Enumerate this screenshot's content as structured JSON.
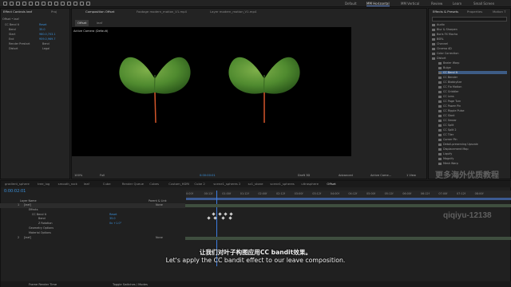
{
  "workspaces": [
    "Default",
    "MM Horizontal",
    "MM Vertical",
    "Review",
    "Learn",
    "Small Screen"
  ],
  "active_workspace_index": 1,
  "effect_controls": {
    "tabs": [
      "Effect Controls leaf",
      "Proj"
    ],
    "subtitle": "Offset • leaf",
    "rows": [
      {
        "label": "CC Bend It",
        "value": "Reset"
      },
      {
        "label": "Bend",
        "value": "35.0"
      },
      {
        "label": "Start",
        "value": "960.0,703.1"
      },
      {
        "label": "End",
        "value": "959.0,969.7"
      },
      {
        "label": "Render Prestart",
        "value": "Bend"
      },
      {
        "label": "Distort",
        "value": "Legal"
      }
    ]
  },
  "composition": {
    "tabs": [
      "Composition Offset",
      "Footage modern_motion_V1.mp4",
      "Layer modern_motion_V1.mp4"
    ],
    "crumbs": [
      "Offset",
      "leaf"
    ],
    "camera_label": "Active Camera (Default)",
    "footer": [
      "100%",
      "Full",
      "0:00:00:01",
      "Draft 3D",
      "Advanced",
      "Active Came...",
      "1 View"
    ]
  },
  "effects_presets": {
    "tabs": [
      "Effects & Presets",
      "Properties",
      "Motion T"
    ],
    "items": [
      "Audio",
      "Blur & Sharpen",
      "Boris FX Mocha",
      "BSRL",
      "Channel",
      "Cinema 4D",
      "Color Correction",
      "Distort",
      "Bezier Warp",
      "Bulge",
      "CC Bend It",
      "CC Bender",
      "CC Blobbylize",
      "CC Flo Motion",
      "CC Griddler",
      "CC Lens",
      "CC Page Turn",
      "CC Power Pin",
      "CC Ripple Pulse",
      "CC Slant",
      "CC Smear",
      "CC Split",
      "CC Split 2",
      "CC Tiler",
      "Corner Pin",
      "Detail-preserving Upscale",
      "Displacement Map",
      "Liquify",
      "Magnify",
      "Mesh Warp"
    ],
    "selected_index": 10
  },
  "timeline": {
    "tabs": [
      "gradient_sphere",
      "tree_log",
      "smooth_rock",
      "leaf",
      "Cube",
      "Render Queue",
      "Cubes",
      "Custom_HDRI",
      "Cube 2",
      "scene1_spheres 2",
      "sc1_stone",
      "scene1_spheres",
      "ultrasphere",
      "Offset"
    ],
    "timecode": "0:00:02:01",
    "columns": [
      "Layer Name",
      "Parent & Link"
    ],
    "layers": [
      {
        "num": "1",
        "name": "[leaf]",
        "parent": "None"
      },
      {
        "name": "Effects",
        "parent": ""
      },
      {
        "name": "CC Bend It",
        "parent": "Reset"
      },
      {
        "name": "Bend",
        "parent": "35.0"
      },
      {
        "name": "Z Rotation",
        "parent": "0x +1.0°"
      },
      {
        "name": "Geometry Options",
        "parent": ""
      },
      {
        "name": "Material Options",
        "parent": ""
      },
      {
        "num": "2",
        "name": "[leaf]",
        "parent": "None"
      }
    ],
    "ruler": [
      "0:00f",
      "00:12f",
      "01:00f",
      "01:12f",
      "02:00f",
      "02:12f",
      "03:00f",
      "03:12f",
      "04:00f",
      "04:12f",
      "05:00f",
      "05:12f",
      "06:00f",
      "06:12f",
      "07:00f",
      "07:12f",
      "08:00f"
    ],
    "footer": [
      "Frame Render Time",
      "Toggle Switches / Modes"
    ]
  },
  "subtitles": {
    "zh": "让我们对叶子构图应用CC bandit效果。",
    "en": "Let's apply the CC bandit effect to our leave composition."
  },
  "watermarks": [
    "更多海外优质教程",
    "qiqiyu-12138"
  ]
}
